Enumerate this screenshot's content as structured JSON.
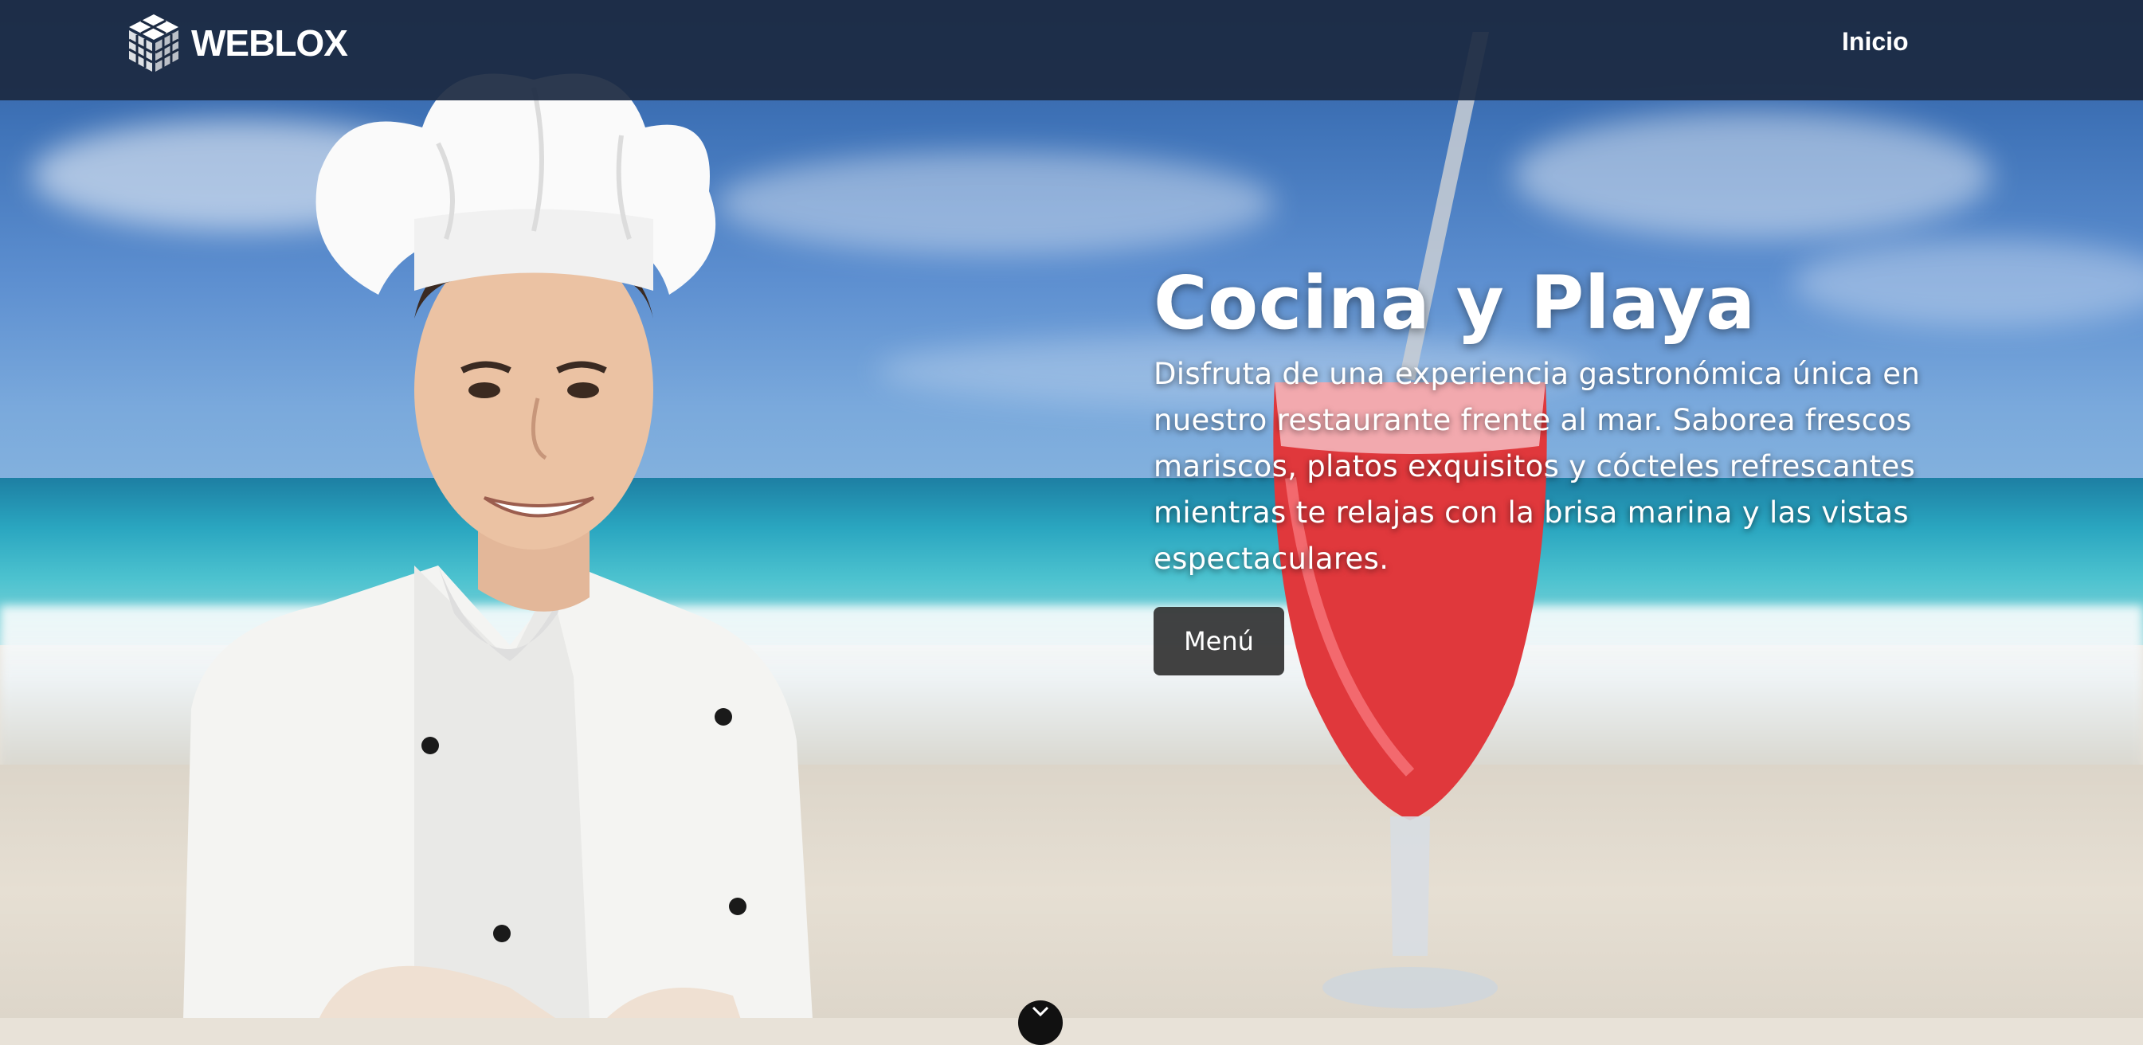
{
  "brand": {
    "name": "WEBLOX",
    "icon": "cube-logo-icon"
  },
  "nav": {
    "items": [
      {
        "label": "Inicio"
      }
    ]
  },
  "hero": {
    "title": "Cocina y Playa",
    "description": "Disfruta de una experiencia gastronómica única en nuestro restaurante frente al mar. Saborea frescos mariscos, platos exquisitos y cócteles refrescantes mientras te relajas con la brisa marina y las vistas espectaculares.",
    "button_label": "Menú"
  },
  "colors": {
    "navbar": "#1c2a42",
    "button": "#282828",
    "text": "#ffffff"
  },
  "icons": {
    "scroll": "chevron-down-icon"
  }
}
